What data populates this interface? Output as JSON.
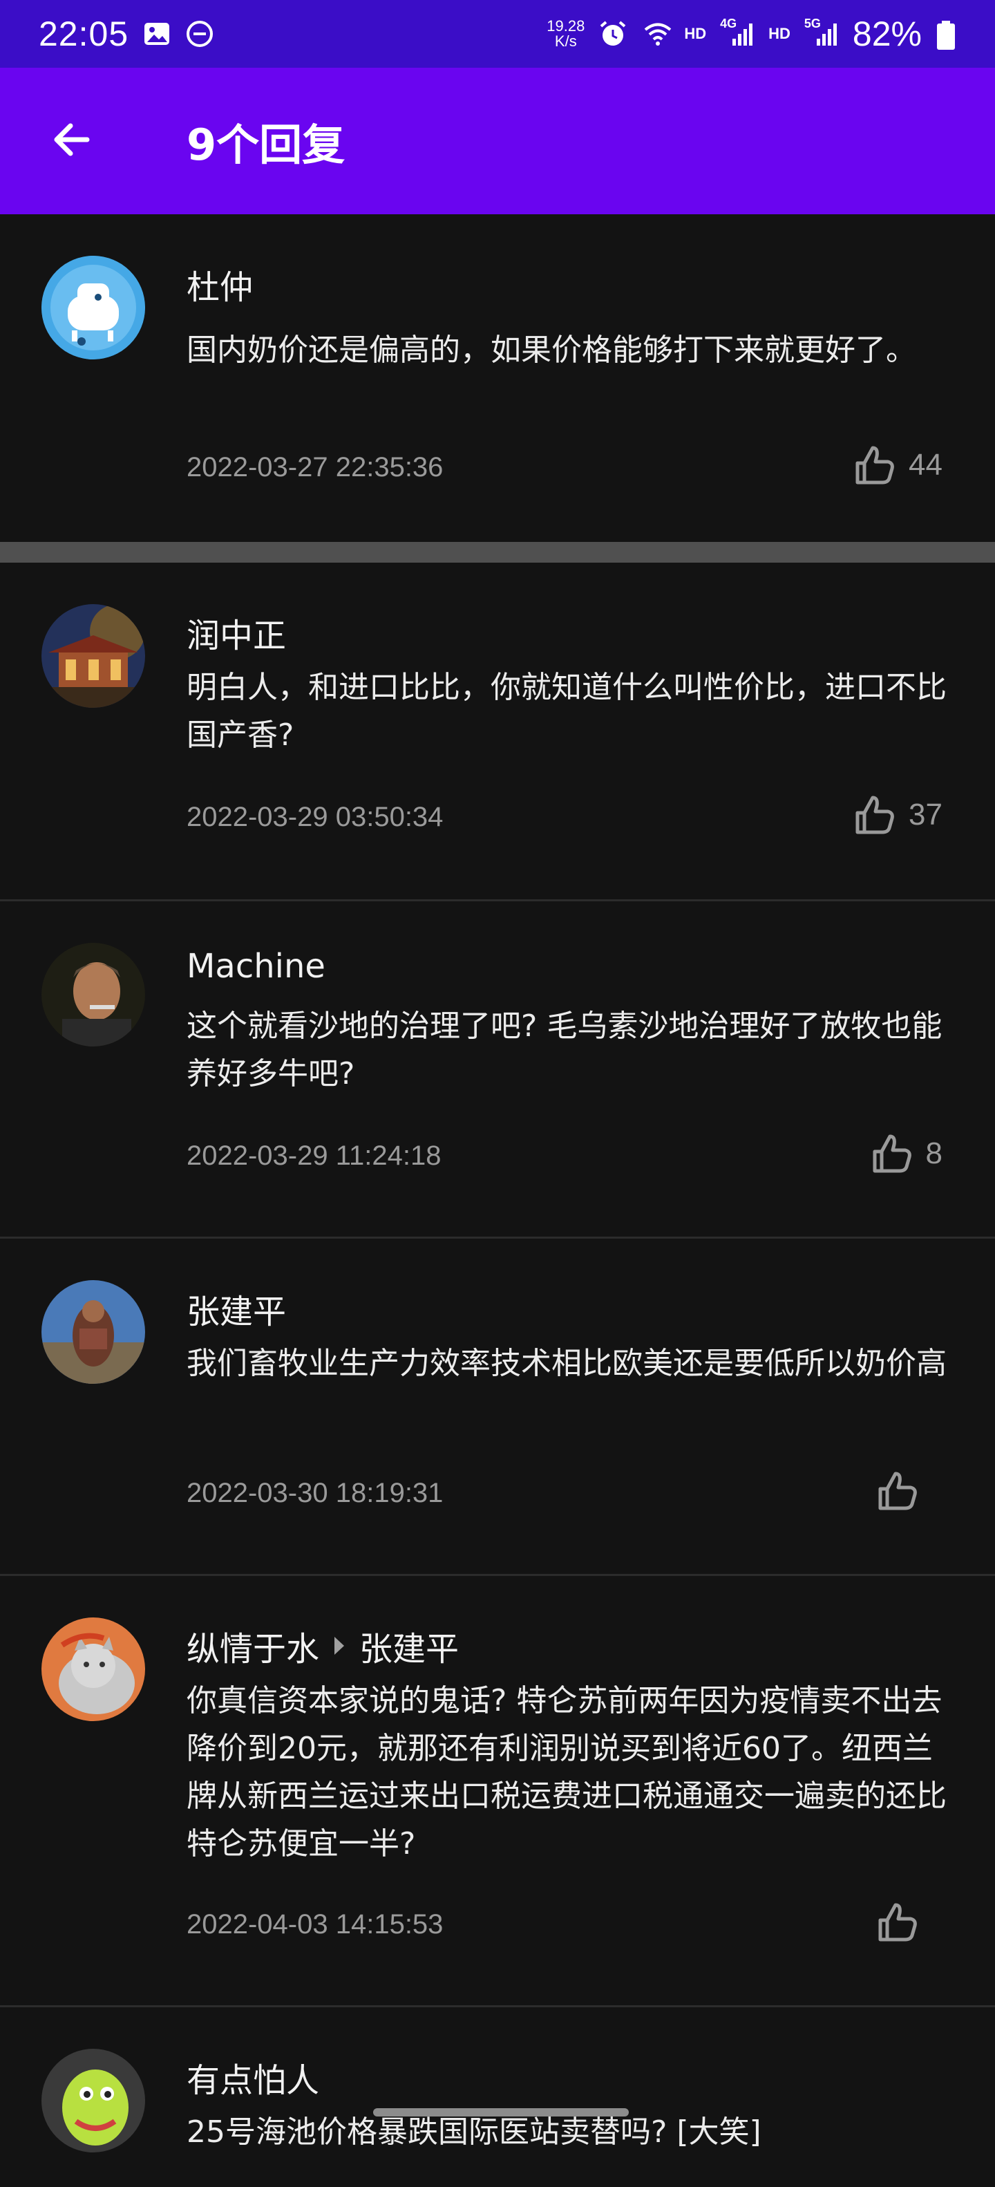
{
  "status_bar": {
    "time": "22:05",
    "net_speed_value": "19.28",
    "net_speed_unit": "K/s",
    "hd1": "HD",
    "sig1": "4G",
    "hd2": "HD",
    "sig2": "5G",
    "battery": "82%",
    "icons": [
      "image-icon",
      "dnd-icon",
      "alarm-icon",
      "wifi-icon",
      "signal-icon",
      "battery-icon"
    ]
  },
  "app_bar": {
    "title": "9个回复",
    "back_icon": "arrow-left-icon"
  },
  "comments": [
    {
      "name": "杜仲",
      "text": "国内奶价还是偏高的，如果价格能够打下来就更好了。",
      "time": "2022-03-27 22:35:36",
      "likes": "44"
    },
    {
      "name": "润中正",
      "text": "明白人，和进口比比，你就知道什么叫性价比，进口不比国产香?",
      "time": "2022-03-29 03:50:34",
      "likes": "37"
    },
    {
      "name": "Machine",
      "text": "这个就看沙地的治理了吧? 毛乌素沙地治理好了放牧也能养好多牛吧?",
      "time": "2022-03-29 11:24:18",
      "likes": "8"
    },
    {
      "name": "张建平",
      "text": "我们畜牧业生产力效率技术相比欧美还是要低所以奶价高",
      "time": "2022-03-30 18:19:31",
      "likes": ""
    },
    {
      "name": "纵情于水",
      "reply_to": "张建平",
      "text": "你真信资本家说的鬼话? 特仑苏前两年因为疫情卖不出去降价到20元，就那还有利润别说买到将近60了。纽西兰牌从新西兰运过来出口税运费进口税通通交一遍卖的还比特仑苏便宜一半?",
      "time": "2022-04-03 14:15:53",
      "likes": ""
    },
    {
      "name": "有点怕人",
      "text": "25号海池价格暴跌国际医站卖替吗? [大笑]",
      "time": "",
      "likes": ""
    }
  ],
  "colors": {
    "status_bar": "#3b0dc7",
    "app_bar": "#6a05f0",
    "background": "#131313"
  }
}
